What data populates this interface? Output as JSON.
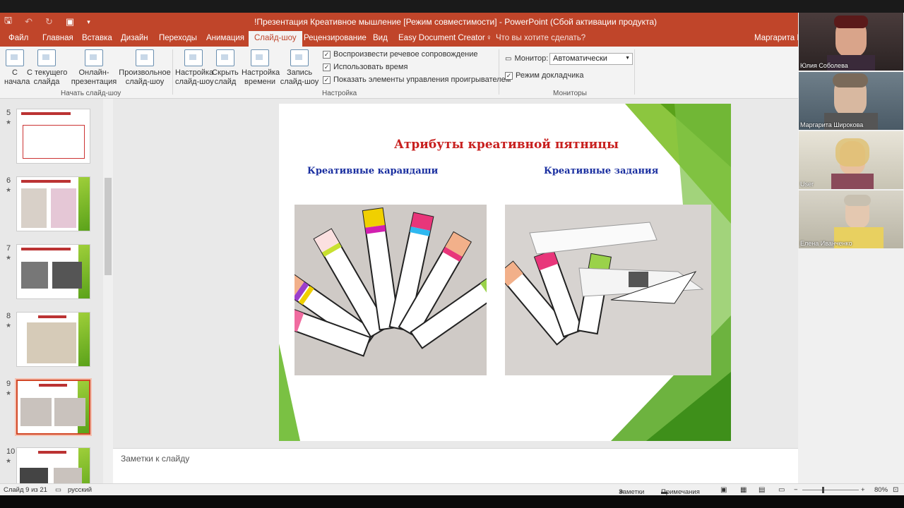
{
  "window": {
    "title": "!Презентация Креативное мышление [Режим совместимости] - PowerPoint (Сбой активации продукта)"
  },
  "qat": {
    "save": "🖫",
    "undo": "↶",
    "redo": "↻",
    "present": "▣",
    "more": "▾"
  },
  "tabs": [
    "Файл",
    "Главная",
    "Вставка",
    "Дизайн",
    "Переходы",
    "Анимация",
    "Слайд-шоу",
    "Рецензирование",
    "Вид",
    "Easy Document Creator"
  ],
  "tell_me": "Что вы хотите сделать?",
  "user_name": "Маргарита Ш",
  "ribbon": {
    "start": {
      "from_start": "С\nначала",
      "from_current": "С текущего\nслайда",
      "online": "Онлайн-\nпрезентация",
      "custom": "Произвольное\nслайд-шоу",
      "group": "Начать слайд-шоу"
    },
    "setup": {
      "setup_show": "Настройка\nслайд-шоу",
      "hide_slide": "Скрыть\nслайд",
      "rehearse": "Настройка\nвремени",
      "record": "Запись\nслайд-шоу",
      "group": "Настройка"
    },
    "checks": [
      "Воспроизвести речевое сопровождение",
      "Использовать время",
      "Показать элементы управления проигрывателем"
    ],
    "monitors": {
      "monitor_label": "Монитор:",
      "monitor_value": "Автоматически",
      "presenter_view": "Режим докладчика",
      "group": "Мониторы"
    }
  },
  "thumbnails": [
    {
      "num": "5"
    },
    {
      "num": "6"
    },
    {
      "num": "7"
    },
    {
      "num": "8"
    },
    {
      "num": "9"
    },
    {
      "num": "10"
    }
  ],
  "slide": {
    "title": "Атрибуты креативной пятницы",
    "left_sub": "Креативные карандаши",
    "right_sub": "Креативные задания"
  },
  "notes_placeholder": "Заметки к слайду",
  "participants": [
    "Юлия Соболева",
    "Маргарита Широкова",
    "User",
    "Елена Иванченко"
  ],
  "status": {
    "slide_info": "Слайд 9 из 21",
    "language": "русский",
    "notes": "Заметки",
    "comments": "Примечания",
    "zoom": "80%"
  },
  "colors": {
    "accent": "#c0452a",
    "title_red": "#c8201f",
    "sub_blue": "#1a2fa0",
    "green": "#7ac143"
  }
}
